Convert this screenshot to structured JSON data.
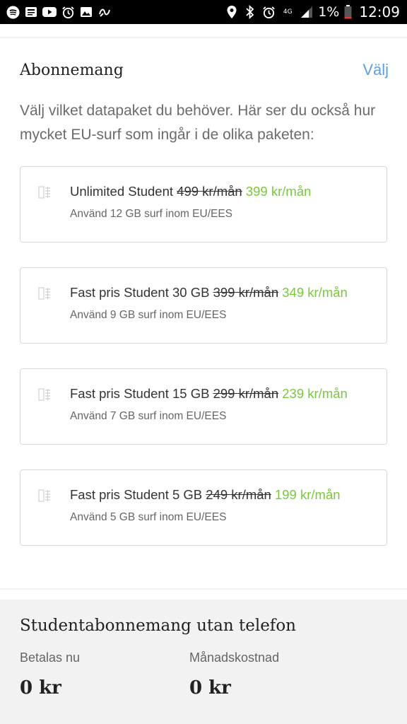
{
  "status_bar": {
    "notification_icons": [
      "spotify-icon",
      "news-icon",
      "youtube-icon",
      "alarm-icon",
      "image-icon",
      "fitness-icon"
    ],
    "system_icons": [
      "location-icon",
      "bluetooth-icon",
      "alarm-icon",
      "network-4g-icon",
      "signal-icon"
    ],
    "network": "4G",
    "battery": "1%",
    "time": "12:09"
  },
  "section": {
    "title": "Abonnemang",
    "action": "Välj",
    "intro": "Välj vilket datapaket du behöver. Här ser du också hur mycket EU-surf som ingår i de olika paketen:"
  },
  "plans": [
    {
      "name": "Unlimited Student",
      "old_price": "499 kr/mån",
      "new_price": "399 kr/mån",
      "detail": "Använd 12 GB surf inom EU/EES"
    },
    {
      "name": "Fast pris Student 30 GB",
      "old_price": "399 kr/mån",
      "new_price": "349 kr/mån",
      "detail": "Använd 9 GB surf inom EU/EES"
    },
    {
      "name": "Fast pris Student 15 GB",
      "old_price": "299 kr/mån",
      "new_price": "239 kr/mån",
      "detail": "Använd 7 GB surf inom EU/EES"
    },
    {
      "name": "Fast pris Student 5 GB",
      "old_price": "249 kr/mån",
      "new_price": "199 kr/mån",
      "detail": "Använd 5 GB surf inom EU/EES"
    }
  ],
  "summary": {
    "title": "Studentabonnemang utan telefon",
    "pay_now_label": "Betalas nu",
    "pay_now_value": "0 kr",
    "monthly_label": "Månadskostnad",
    "monthly_value": "0 kr"
  },
  "colors": {
    "accent_blue": "#5aa0e6",
    "price_green": "#77c93a",
    "border": "#d8d8d8"
  }
}
